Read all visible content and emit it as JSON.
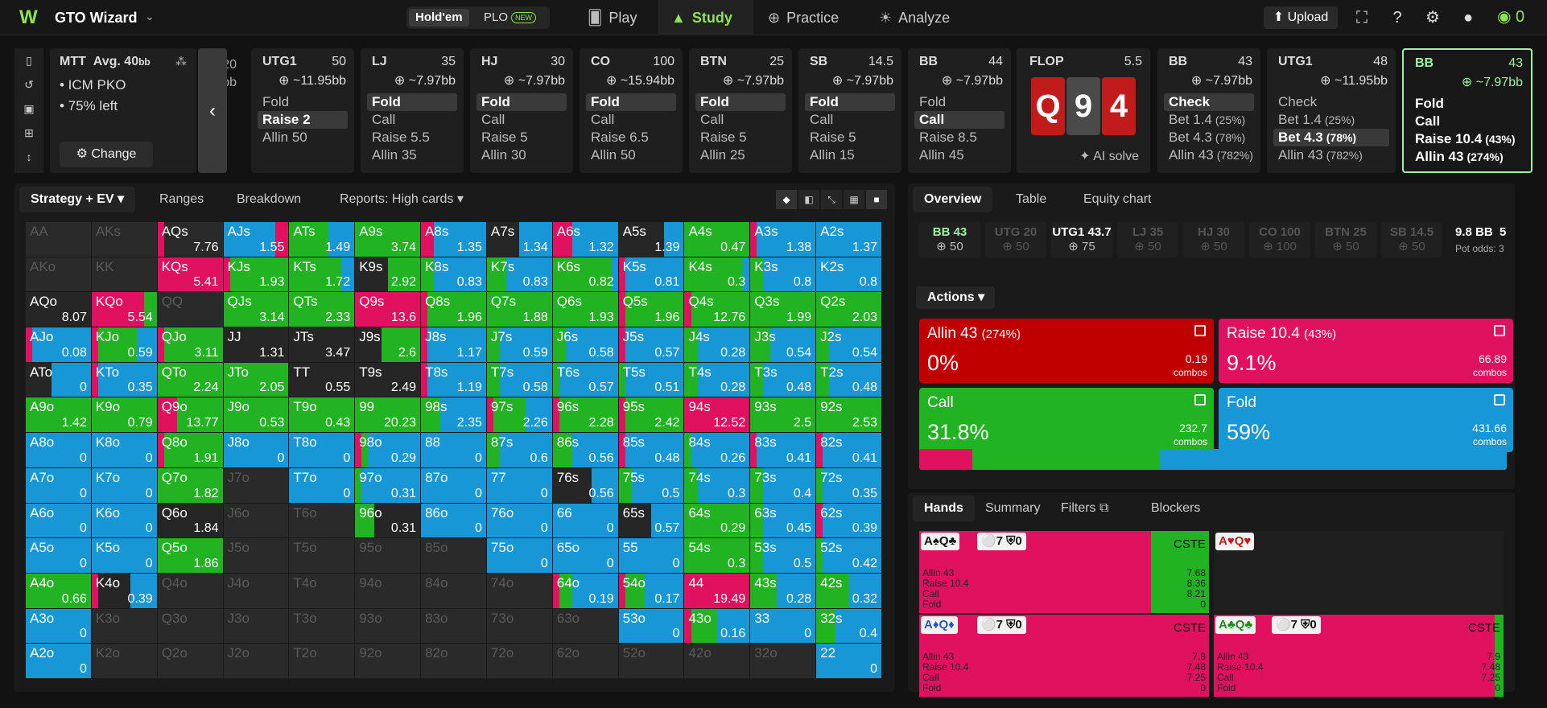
{
  "topbar": {
    "app_name": "GTO Wizard",
    "holdem": "Hold'em",
    "plo": "PLO",
    "plo_badge": "NEW",
    "nav": [
      {
        "label": "Play",
        "icon": "cards-icon"
      },
      {
        "label": "Study",
        "icon": "graduation-cap-icon"
      },
      {
        "label": "Practice",
        "icon": "gamepad-icon"
      },
      {
        "label": "Analyze",
        "icon": "lightbulb-icon"
      }
    ],
    "upload": "Upload",
    "credits": "0"
  },
  "mtt": {
    "title": "MTT",
    "avg_label": "Avg. 40",
    "avg_unit": "bb",
    "lines": [
      "• ICM PKO",
      "• 75% left"
    ],
    "change": "Change"
  },
  "prev_hint": {
    "stack": "20",
    "eq": "97bb"
  },
  "cards": [
    {
      "pos": "UTG1",
      "stack": "50",
      "eq": "~11.95bb",
      "acts": [
        {
          "l": "Fold"
        },
        {
          "l": "Raise 2",
          "sel": true
        },
        {
          "l": "Allin 50"
        }
      ]
    },
    {
      "pos": "LJ",
      "stack": "35",
      "eq": "~7.97bb",
      "acts": [
        {
          "l": "Fold",
          "sel": true
        },
        {
          "l": "Call"
        },
        {
          "l": "Raise 5.5"
        },
        {
          "l": "Allin 35"
        }
      ]
    },
    {
      "pos": "HJ",
      "stack": "30",
      "eq": "~7.97bb",
      "acts": [
        {
          "l": "Fold",
          "sel": true
        },
        {
          "l": "Call"
        },
        {
          "l": "Raise 5"
        },
        {
          "l": "Allin 30"
        }
      ]
    },
    {
      "pos": "CO",
      "stack": "100",
      "eq": "~15.94bb",
      "acts": [
        {
          "l": "Fold",
          "sel": true
        },
        {
          "l": "Call"
        },
        {
          "l": "Raise 6.5"
        },
        {
          "l": "Allin 50"
        }
      ]
    },
    {
      "pos": "BTN",
      "stack": "25",
      "eq": "~7.97bb",
      "acts": [
        {
          "l": "Fold",
          "sel": true
        },
        {
          "l": "Call"
        },
        {
          "l": "Raise 5"
        },
        {
          "l": "Allin 25"
        }
      ]
    },
    {
      "pos": "SB",
      "stack": "14.5",
      "eq": "~7.97bb",
      "acts": [
        {
          "l": "Fold",
          "sel": true
        },
        {
          "l": "Call"
        },
        {
          "l": "Raise 5"
        },
        {
          "l": "Allin 15"
        }
      ]
    },
    {
      "pos": "BB",
      "stack": "44",
      "eq": "~7.97bb",
      "acts": [
        {
          "l": "Fold"
        },
        {
          "l": "Call",
          "sel": true
        },
        {
          "l": "Raise 8.5"
        },
        {
          "l": "Allin 45"
        }
      ]
    }
  ],
  "flop": {
    "label": "FLOP",
    "pot": "5.5",
    "cards": [
      {
        "r": "Q",
        "c": "#c21b1b"
      },
      {
        "r": "9",
        "c": "#4a4a4a"
      },
      {
        "r": "4",
        "c": "#c21b1b"
      }
    ],
    "ai": "AI solve"
  },
  "cards2": [
    {
      "pos": "BB",
      "stack": "43",
      "eq": "~7.97bb",
      "acts": [
        {
          "l": "Check",
          "sel": true
        },
        {
          "l": "Bet 1.4",
          "p": "(25%)"
        },
        {
          "l": "Bet 4.3",
          "p": "(78%)"
        },
        {
          "l": "Allin 43",
          "p": "(782%)"
        }
      ]
    },
    {
      "pos": "UTG1",
      "stack": "48",
      "eq": "~11.95bb",
      "acts": [
        {
          "l": "Check"
        },
        {
          "l": "Bet 1.4",
          "p": "(25%)"
        },
        {
          "l": "Bet 4.3",
          "p": "(78%)",
          "sel": true
        },
        {
          "l": "Allin 43",
          "p": "(782%)"
        }
      ]
    },
    {
      "pos": "BB",
      "stack": "43",
      "eq": "~7.97bb",
      "acts": [
        {
          "l": "Fold"
        },
        {
          "l": "Call"
        },
        {
          "l": "Raise 10.4",
          "p": "(43%)"
        },
        {
          "l": "Allin 43",
          "p": "(274%)"
        }
      ]
    }
  ],
  "left_tabs": [
    "Strategy + EV",
    "Ranges",
    "Breakdown",
    "Reports: High cards"
  ],
  "colors": {
    "allin": "#c00000",
    "raise": "#e0115f",
    "call": "#22b322",
    "fold": "#1797d6",
    "dark": "#262626"
  },
  "matrix": [
    [
      "AA||",
      "AKs||",
      "AQs|7.76|R1",
      "AJs|1.55|F8R2",
      "ATs|1.49|G6F4",
      "A9s|3.74|G10",
      "A8s|1.35|R2F8",
      "A7s|1.34|X5F5",
      "A6s|1.32|R3F7",
      "A5s|1.39|X7F3",
      "A4s|0.47|G10",
      "A3s|1.38|R1F9",
      "A2s|1.37|F10"
    ],
    [
      "AKo||",
      "KK||",
      "KQs|5.41|R10",
      "KJs|1.93|R1G9",
      "KTs|1.72|G8F2",
      "K9s|2.92|X5G5",
      "K8s|0.83|G2F8",
      "K7s|0.83|G3F7",
      "K6s|0.82|G9F1",
      "K5s|0.81|R1F9",
      "K4s|0.3|G9F1",
      "K3s|0.8|G2F8",
      "K2s|0.8|F10"
    ],
    [
      "AQo|8.07|X10",
      "KQo|5.54|R8G2",
      "QQ||",
      "QJs|3.14|G10",
      "QTs|2.33|G10",
      "Q9s|13.6|R10",
      "Q8s|1.96|R1G9",
      "Q7s|1.88|G10",
      "Q6s|1.93|G10",
      "Q5s|1.96|R1G9",
      "Q4s|12.76|R1G9",
      "Q3s|1.99|G10",
      "Q2s|2.03|G10"
    ],
    [
      "AJo|0.08|R1F9",
      "KJo|0.59|R1G6F3",
      "QJo|3.11|R1G9",
      "JJ|1.31|X10",
      "JTs|3.47|X10",
      "J9s|2.6|X4G6",
      "J8s|1.17|R1F9",
      "J7s|0.59|G2F8",
      "J6s|0.58|G2F8",
      "J5s|0.57|R1F9",
      "J4s|0.28|G2F8",
      "J3s|0.54|G3F7",
      "J2s|0.54|G2F8"
    ],
    [
      "ATo|0|X4F6",
      "KTo|0.35|R1F9",
      "QTo|2.24|G10",
      "JTo|2.05|G10",
      "TT|0.55|X10",
      "T9s|2.49|X10",
      "T8s|1.19|R1F9",
      "T7s|0.58|G2F8",
      "T6s|0.57|G1F9",
      "T5s|0.51|G1F9",
      "T4s|0.28|G2F8",
      "T3s|0.48|G2F8",
      "T2s|0.48|G2F8"
    ],
    [
      "A9o|1.42|G10",
      "K9o|0.79|G10",
      "Q9o|13.77|R3G7",
      "J9o|0.53|G10",
      "T9o|0.43|G10",
      "99|20.23|G10",
      "98s|2.35|G3F7",
      "97s|2.26|R1G5F4",
      "96s|2.28|R1G9",
      "95s|2.42|R1G9",
      "94s|12.52|R10",
      "93s|2.5|G10",
      "92s|2.53|G10"
    ],
    [
      "A8o|0|F10",
      "K8o|0|F10",
      "Q8o|1.91|R1G9",
      "J8o|0|F10",
      "T8o|0|F10",
      "98o|0.29|R1G1F8",
      "88|0|F10",
      "87s|0.6|G2F8",
      "86s|0.56|G3F7",
      "85s|0.48|R1F9",
      "84s|0.26|G1F9",
      "83s|0.41|R1F9",
      "82s|0.41|R1F9"
    ],
    [
      "A7o|0|F10",
      "K7o|0|F10",
      "Q7o|1.82|G10",
      "J7o||",
      "T7o|0|F10",
      "97o|0.31|G1F9",
      "87o|0|F10",
      "77|0|F10",
      "76s|0.56|X6F4",
      "75s|0.5|G2F8",
      "74s|0.3|G2F8",
      "73s|0.4|G2F8",
      "72s|0.35|G1F9"
    ],
    [
      "A6o|0|F10",
      "K6o|0|F10",
      "Q6o|1.84|X10",
      "J6o||",
      "T6o||",
      "96o|0.31|G3X7",
      "86o|0|F10",
      "76o|0|F10",
      "66|0|F10",
      "65s|0.57|X5F5",
      "64s|0.29|G10",
      "63s|0.45|G2F8",
      "62s|0.39|R1F9"
    ],
    [
      "A5o|0|F10",
      "K5o|0|F10",
      "Q5o|1.86|G10",
      "J5o||",
      "T5o||",
      "95o||",
      "85o||",
      "75o|0|F10",
      "65o|0|F10",
      "55|0|F10",
      "54s|0.3|G10",
      "53s|0.5|G2F8",
      "52s|0.42|G1F9"
    ],
    [
      "A4o|0.66|G10",
      "K4o|0.39|R1X5F4",
      "Q4o||",
      "J4o||",
      "T4o||",
      "94o||",
      "84o||",
      "74o||",
      "64o|0.19|R1G2F7",
      "54o|0.17|R1G3F6",
      "44|19.49|R10",
      "43s|0.28|G4F6",
      "42s|0.32|G5F5"
    ],
    [
      "A3o|0|F10",
      "K3o||",
      "Q3o||",
      "J3o||",
      "T3o||",
      "93o||",
      "83o||",
      "73o||",
      "63o||",
      "53o|0|F10",
      "43o|0.16|R1G4F5",
      "33|0|F10",
      "32s|0.4|G3F7"
    ],
    [
      "A2o|0|F10",
      "K2o||",
      "Q2o||",
      "J2o||",
      "T2o||",
      "92o||",
      "82o||",
      "72o||",
      "62o||",
      "52o||",
      "42o||",
      "32o||",
      "22|0|F10"
    ]
  ],
  "right_tabs": [
    "Overview",
    "Table",
    "Equity chart"
  ],
  "players": [
    {
      "n": "BB 43",
      "s": "50",
      "st": 1
    },
    {
      "n": "UTG 20",
      "s": "50",
      "st": 0
    },
    {
      "n": "UTG1 43.7",
      "s": "75",
      "st": 2
    },
    {
      "n": "LJ 35",
      "s": "50",
      "st": 0
    },
    {
      "n": "HJ 30",
      "s": "50",
      "st": 0
    },
    {
      "n": "CO 100",
      "s": "100",
      "st": 0
    },
    {
      "n": "BTN 25",
      "s": "50",
      "st": 0
    },
    {
      "n": "SB 14.5",
      "s": "50",
      "st": 0
    }
  ],
  "pot": {
    "bb": "9.8 BB",
    "extra": "5",
    "odds_label": "Pot odds:",
    "odds_val": "3"
  },
  "actions_label": "Actions",
  "action_boxes": [
    {
      "label": "Allin 43",
      "pct_label": "(274%)",
      "freq": "0%",
      "combos": "0.19",
      "combos_label": "combos",
      "color": "#c00000"
    },
    {
      "label": "Raise 10.4",
      "pct_label": "(43%)",
      "freq": "9.1%",
      "combos": "66.89",
      "combos_label": "combos",
      "color": "#e0115f"
    },
    {
      "label": "Call",
      "pct_label": "",
      "freq": "31.8%",
      "combos": "232.7",
      "combos_label": "combos",
      "color": "#22b322"
    },
    {
      "label": "Fold",
      "pct_label": "",
      "freq": "59%",
      "combos": "431.66",
      "combos_label": "combos",
      "color": "#1797d6"
    }
  ],
  "freq_bar": [
    {
      "c": "#e0115f",
      "w": 9.1
    },
    {
      "c": "#22b322",
      "w": 31.8
    },
    {
      "c": "#1797d6",
      "w": 59.1
    }
  ],
  "hands_tabs": [
    "Hands",
    "Summary",
    "Filters",
    "Blockers"
  ],
  "hands": [
    {
      "cards": [
        {
          "t": "A",
          "c": "k"
        },
        {
          "t": "♠",
          "c": "k"
        },
        {
          "t": "Q",
          "c": "k"
        },
        {
          "t": "♣",
          "c": "k"
        }
      ],
      "stat": "⚪7 ⛨0",
      "cste": "CSTE",
      "lines": [
        "Allin 43",
        "Raise 10.4",
        "Call",
        "Fold"
      ],
      "vals": [
        "7.68",
        "8.36",
        "8.21",
        "0"
      ],
      "raise": 80,
      "call": 20
    },
    {
      "cards": [
        {
          "t": "A",
          "c": "r"
        },
        {
          "t": "♥",
          "c": "r"
        },
        {
          "t": "Q",
          "c": "r"
        },
        {
          "t": "♥",
          "c": "r"
        }
      ],
      "stat": "",
      "cste": "",
      "lines": [],
      "vals": [],
      "raise": 0,
      "call": 0
    },
    {
      "cards": [
        {
          "t": "A",
          "c": "b"
        },
        {
          "t": "♦",
          "c": "b"
        },
        {
          "t": "Q",
          "c": "b"
        },
        {
          "t": "♦",
          "c": "b"
        }
      ],
      "stat": "⚪7 ⛨0",
      "cste": "CSTE",
      "lines": [
        "Allin 43",
        "Raise 10.4",
        "Call",
        "Fold"
      ],
      "vals": [
        "7.8",
        "7.48",
        "7.25",
        "0"
      ],
      "raise": 100,
      "call": 0
    },
    {
      "cards": [
        {
          "t": "A",
          "c": "g"
        },
        {
          "t": "♣",
          "c": "g"
        },
        {
          "t": "Q",
          "c": "g"
        },
        {
          "t": "♣",
          "c": "g"
        }
      ],
      "stat": "⚪7 ⛨0",
      "cste": "CSTE",
      "lines": [
        "Allin 43",
        "Raise 10.4",
        "Call",
        "Fold"
      ],
      "vals": [
        "7.9",
        "7.48",
        "7.25",
        "0"
      ],
      "raise": 97,
      "call": 3
    }
  ]
}
